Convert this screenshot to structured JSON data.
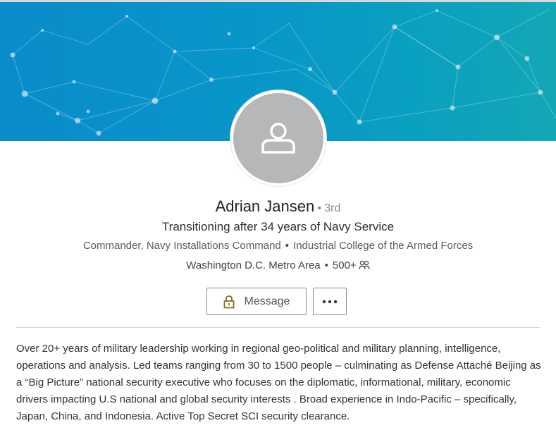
{
  "profile": {
    "name": "Adrian Jansen",
    "degree": "• 3rd",
    "headline": "Transitioning after 34 years of Navy Service",
    "current_position": "Commander, Navy Installations Command",
    "separator": "•",
    "education": "Industrial College of the Armed Forces",
    "location": "Washington D.C. Metro Area",
    "connections": "500+"
  },
  "actions": {
    "message_label": "Message",
    "more_label": "..."
  },
  "summary": {
    "text": "Over 20+ years of military leadership working in regional geo-political and military planning, intelligence, operations and analysis. Led teams ranging from 30 to 1500 people – culminating as Defense Attaché Beijing as a “Big Picture” national security executive who focuses on the diplomatic, informational, military, economic drivers impacting U.S national and global security interests . Broad experience in Indo-Pacific – specifically, Japan, China, and Indonesia. Active Top Secret SCI security clearance."
  },
  "icons": {
    "avatar": "person-silhouette-icon",
    "connections": "people-icon",
    "message": "lock-icon",
    "more": "ellipsis-icon"
  },
  "colors": {
    "banner_start": "#0a8ccb",
    "banner_end": "#13a7b6",
    "avatar_bg": "#b5b7b8",
    "lock_icon": "#8a6d2b"
  }
}
